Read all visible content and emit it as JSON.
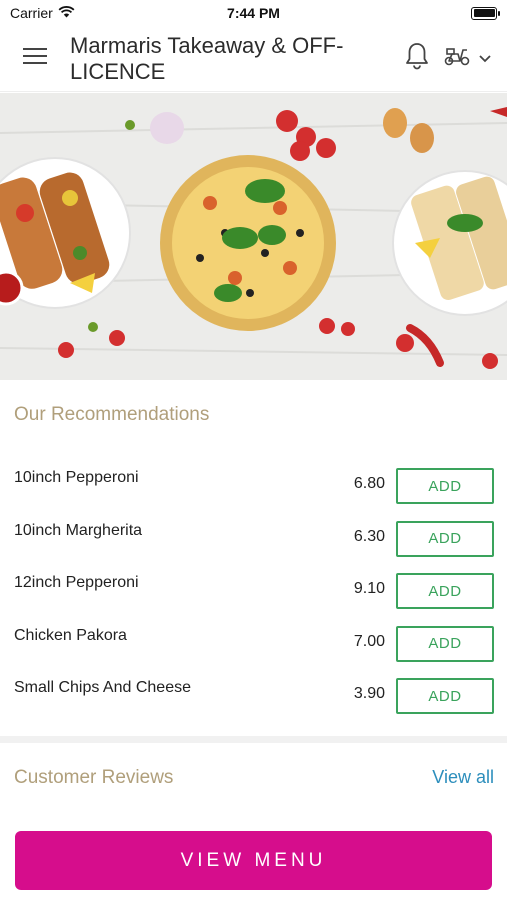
{
  "status": {
    "carrier": "Carrier",
    "time": "7:44 PM"
  },
  "header": {
    "title": "Marmaris Takeaway & OFF-LICENCE"
  },
  "recommendations": {
    "title": "Our Recommendations",
    "add_label": "ADD",
    "items": [
      {
        "name": "10inch Pepperoni",
        "price": "6.80"
      },
      {
        "name": "10inch Margherita",
        "price": "6.30"
      },
      {
        "name": "12inch Pepperoni",
        "price": "9.10"
      },
      {
        "name": "Chicken Pakora",
        "price": "7.00"
      },
      {
        "name": "Small Chips And Cheese",
        "price": "3.90"
      }
    ]
  },
  "reviews": {
    "title": "Customer Reviews",
    "view_all": "View all"
  },
  "footer": {
    "view_menu": "VIEW MENU"
  },
  "colors": {
    "brand_pink": "#d60d8c",
    "add_green": "#3aa35c",
    "section_title": "#b09f7b",
    "link_blue": "#2c8ebc"
  },
  "icons": [
    "hamburger-menu-icon",
    "bell-icon",
    "scooter-icon",
    "chevron-down-icon",
    "wifi-icon",
    "battery-icon"
  ]
}
